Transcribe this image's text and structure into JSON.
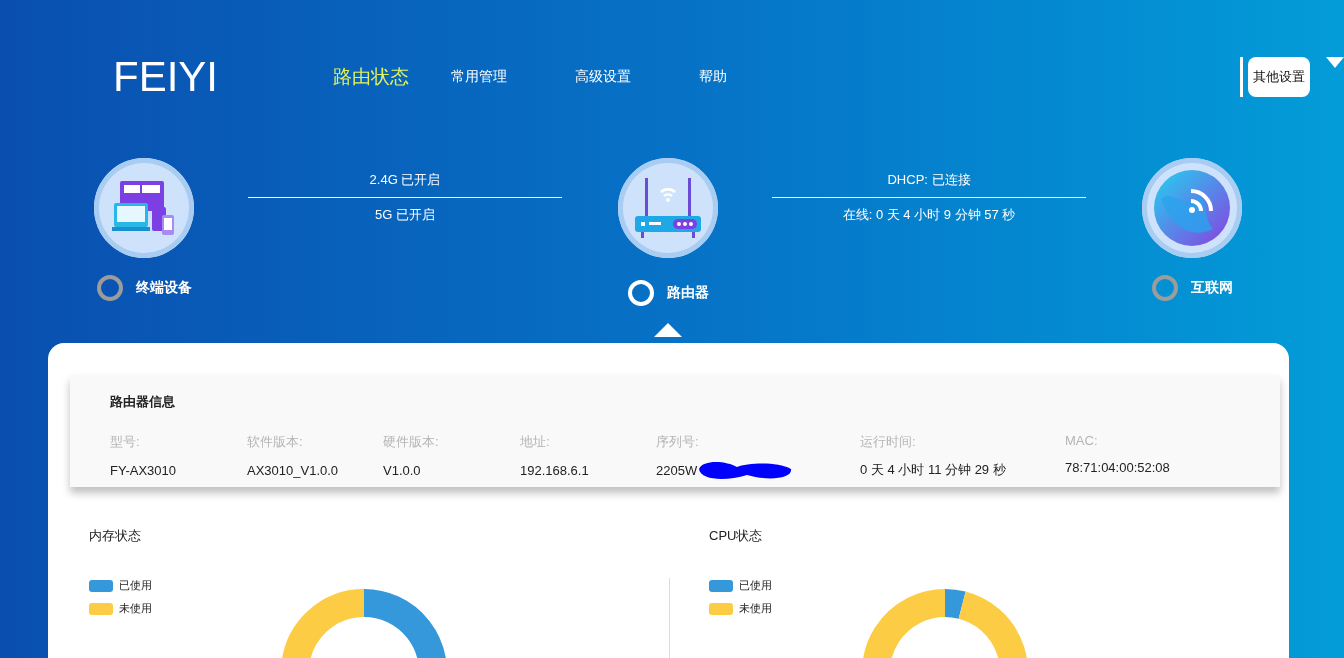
{
  "brand": "FEIYI",
  "nav": [
    {
      "label": "路由状态",
      "selected": true
    },
    {
      "label": "常用管理",
      "selected": false
    },
    {
      "label": "高级设置",
      "selected": false
    },
    {
      "label": "帮助",
      "selected": false
    }
  ],
  "other_settings": "其他设置",
  "links": [
    {
      "line_1": "2.4G 已开启",
      "line_2": "5G 已开启"
    },
    {
      "line_1": "DHCP: 已连接",
      "line_2": "在线: 0 天 4 小时 9 分钟 57 秒"
    }
  ],
  "nodes": [
    {
      "kind": "devices",
      "label": "终端设备",
      "selected": false
    },
    {
      "kind": "router",
      "label": "路由器",
      "selected": true
    },
    {
      "kind": "internet",
      "label": "互联网",
      "selected": false
    }
  ],
  "router_info": {
    "title": "路由器信息",
    "fields": [
      {
        "label": "型号:",
        "value": "FY-AX3010"
      },
      {
        "label": "软件版本:",
        "value": "AX3010_V1.0.0"
      },
      {
        "label": "硬件版本:",
        "value": "V1.0.0"
      },
      {
        "label": "地址:",
        "value": "192.168.6.1"
      },
      {
        "label": "序列号:",
        "value": "2205W",
        "redacted": true
      },
      {
        "label": "运行时间:",
        "value": "0 天 4 小时 11 分钟 29 秒"
      },
      {
        "label": "MAC:",
        "value": "78:71:04:00:52:08"
      }
    ]
  },
  "charts": [
    {
      "title": "内存状态",
      "legend": [
        {
          "label": "已使用",
          "color": "#3498db"
        },
        {
          "label": "未使用",
          "color": "#fccc44"
        }
      ]
    },
    {
      "title": "CPU状态",
      "legend": [
        {
          "label": "已使用",
          "color": "#3498db"
        },
        {
          "label": "未使用",
          "color": "#fccc44"
        }
      ]
    }
  ]
}
